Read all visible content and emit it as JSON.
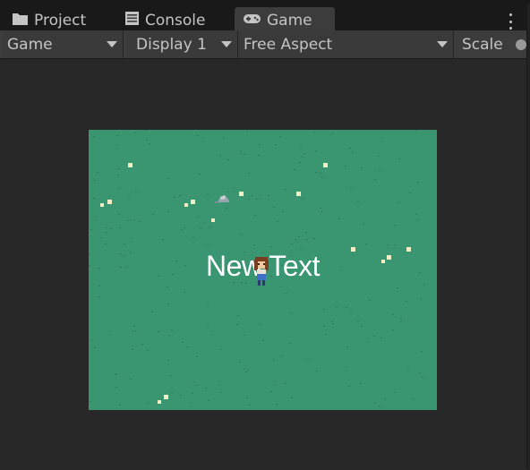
{
  "tabs": [
    {
      "label": "Project",
      "icon": "folder-icon",
      "active": false
    },
    {
      "label": "Console",
      "icon": "console-icon",
      "active": false
    },
    {
      "label": "Game",
      "icon": "gamepad-icon",
      "active": true
    }
  ],
  "toolbar": {
    "view_mode": "Game",
    "display": "Display 1",
    "aspect": "Free Aspect",
    "scale_label": "Scale"
  },
  "game": {
    "ui_text": "New Text"
  },
  "colors": {
    "grass": "#3a9571",
    "editor_bg": "#282828",
    "tab_active": "#3c3c3c",
    "text": "#c4c4c4"
  }
}
